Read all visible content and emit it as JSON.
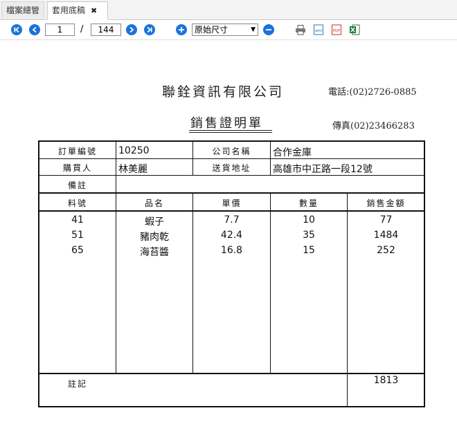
{
  "tabs": [
    {
      "label": "檔案總管"
    },
    {
      "label": "套用底稿",
      "close": "✖"
    }
  ],
  "toolbar": {
    "current_page": "1",
    "page_separator": "/",
    "total_pages": "144",
    "zoom_selected": "原始尺寸",
    "icons": [
      "first-page-icon",
      "prev-page-icon",
      "next-page-icon",
      "last-page-icon",
      "zoom-in-icon",
      "zoom-out-icon",
      "print-icon",
      "xml-icon",
      "pdf-icon",
      "excel-icon"
    ],
    "export": {
      "xml": "xml",
      "pdf": "PDF"
    }
  },
  "document": {
    "company": "聯銓資訊有限公司",
    "phone": "電話:(02)2726-0885",
    "title": "銷售證明單",
    "fax": "傳真(02)23466283",
    "order_no_label": "訂單編號",
    "order_no": "10250",
    "company_name_label": "公司名稱",
    "company_name": "合作金庫",
    "buyer_label": "購買人",
    "buyer": "林美麗",
    "address_label": "送貨地址",
    "address": "高雄市中正路一段12號",
    "note_label": "備註",
    "note": "",
    "columns": [
      "料號",
      "品名",
      "單價",
      "數量",
      "銷售金額"
    ],
    "rows": [
      {
        "id": "41",
        "name": "蝦子",
        "price": "7.7",
        "qty": "10",
        "amount": "77"
      },
      {
        "id": "51",
        "name": "豬肉乾",
        "price": "42.4",
        "qty": "35",
        "amount": "1484"
      },
      {
        "id": "65",
        "name": "海苔醬",
        "price": "16.8",
        "qty": "15",
        "amount": "252"
      }
    ],
    "remark_label": "註記",
    "total": "1813"
  }
}
